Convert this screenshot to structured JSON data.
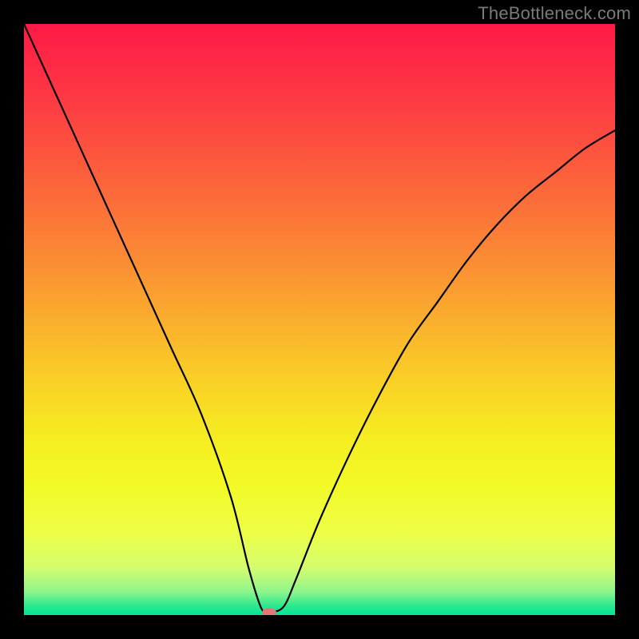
{
  "watermark": "TheBottleneck.com",
  "chart_data": {
    "type": "line",
    "title": "",
    "xlabel": "",
    "ylabel": "",
    "xlim": [
      0,
      100
    ],
    "ylim": [
      0,
      100
    ],
    "grid": false,
    "legend": false,
    "annotations": [],
    "series": [
      {
        "name": "bottleneck-curve",
        "color": "#000000",
        "x": [
          0,
          5,
          10,
          15,
          20,
          25,
          30,
          35,
          38,
          40,
          41,
          42,
          44,
          46,
          50,
          55,
          60,
          65,
          70,
          75,
          80,
          85,
          90,
          95,
          100
        ],
        "y": [
          100,
          89,
          78,
          67,
          56,
          45,
          34,
          20,
          8,
          1.5,
          0.5,
          0.5,
          1.5,
          6,
          16,
          27,
          37,
          46,
          53,
          60,
          66,
          71,
          75,
          79,
          82
        ]
      }
    ],
    "marker": {
      "name": "optimal-point",
      "x": 41.5,
      "y": 0.4,
      "color": "#e17877",
      "rx": 9,
      "ry": 6
    },
    "background": {
      "type": "vertical-gradient",
      "stops": [
        {
          "offset": 0.0,
          "color": "#fe1a47"
        },
        {
          "offset": 0.1,
          "color": "#fe3244"
        },
        {
          "offset": 0.2,
          "color": "#fd4f3f"
        },
        {
          "offset": 0.3,
          "color": "#fc6d3a"
        },
        {
          "offset": 0.4,
          "color": "#fb8c34"
        },
        {
          "offset": 0.5,
          "color": "#faae2d"
        },
        {
          "offset": 0.6,
          "color": "#f9cf26"
        },
        {
          "offset": 0.7,
          "color": "#f6ed21"
        },
        {
          "offset": 0.78,
          "color": "#f2fa26"
        },
        {
          "offset": 0.86,
          "color": "#eefe46"
        },
        {
          "offset": 0.92,
          "color": "#d4fd6e"
        },
        {
          "offset": 0.96,
          "color": "#8ff58c"
        },
        {
          "offset": 0.985,
          "color": "#2ae98f"
        },
        {
          "offset": 1.0,
          "color": "#04e494"
        }
      ]
    }
  }
}
